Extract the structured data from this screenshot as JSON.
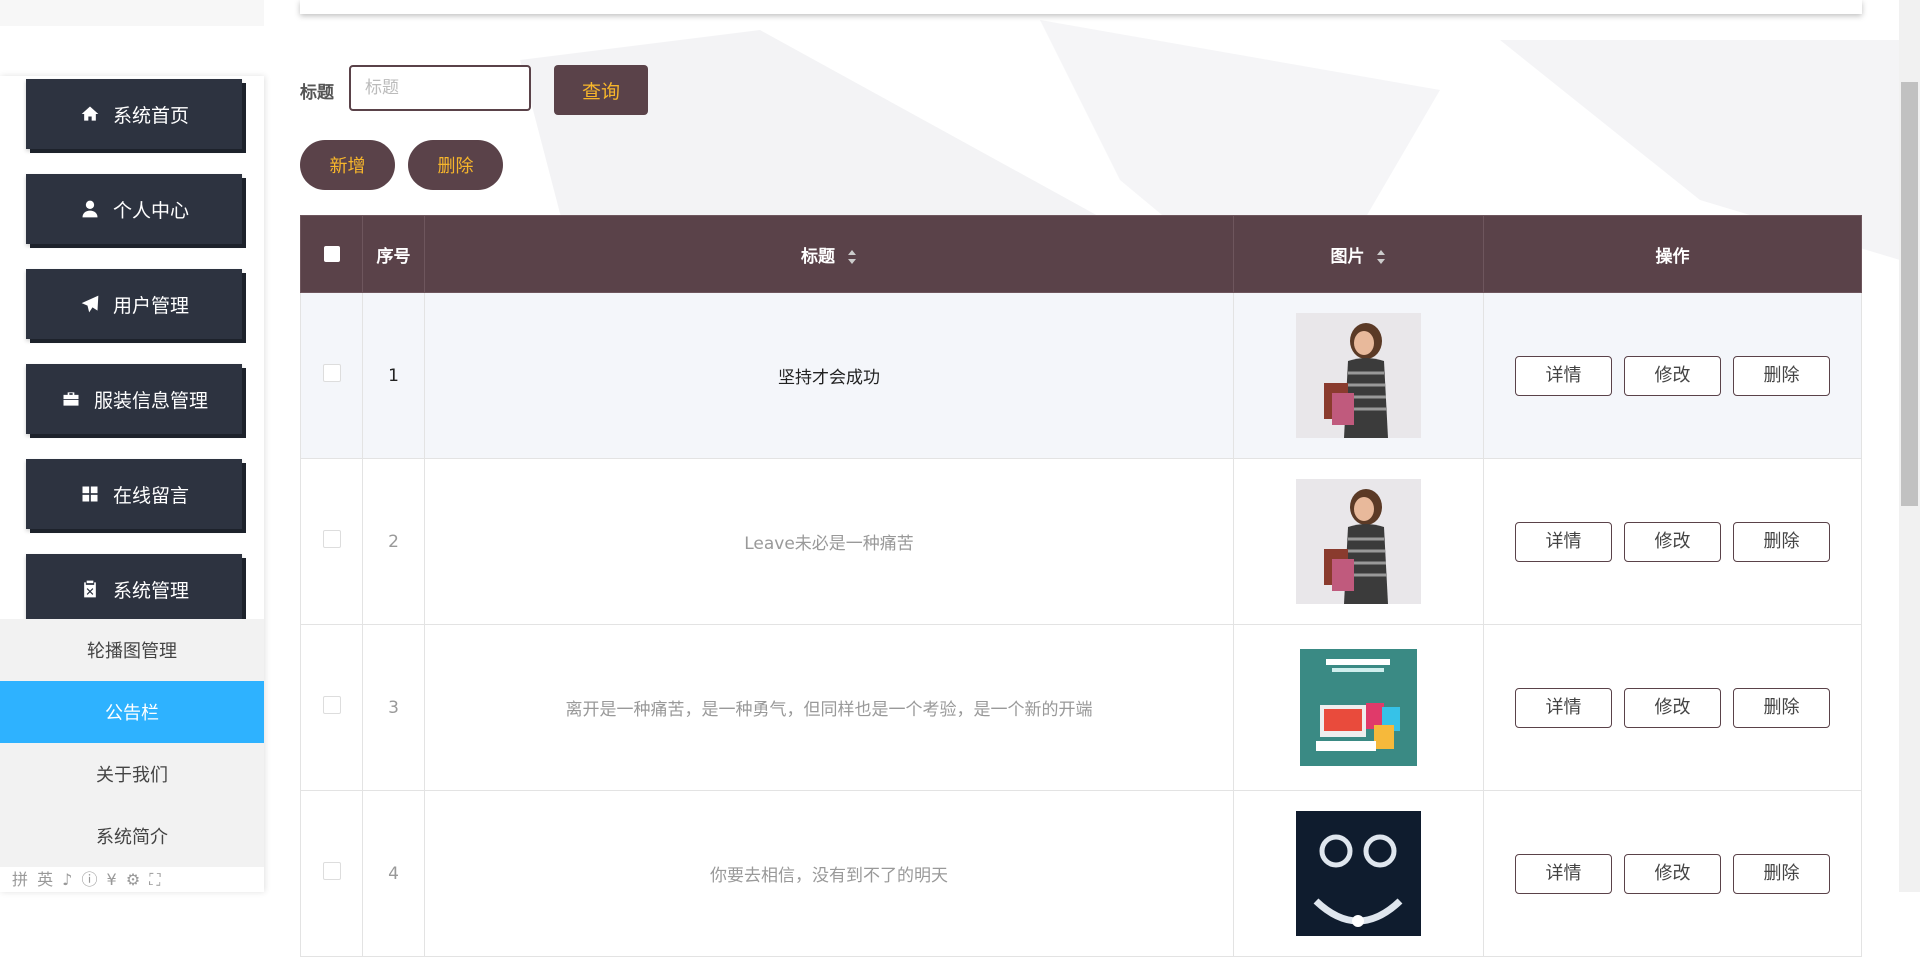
{
  "sidebar": {
    "items": [
      {
        "label": "系统首页",
        "icon": "home-icon"
      },
      {
        "label": "个人中心",
        "icon": "user-icon"
      },
      {
        "label": "用户管理",
        "icon": "paper-plane-icon"
      },
      {
        "label": "服装信息管理",
        "icon": "briefcase-icon"
      },
      {
        "label": "在线留言",
        "icon": "grid-icon"
      },
      {
        "label": "系统管理",
        "icon": "clipboard-icon"
      }
    ],
    "submenu": [
      {
        "label": "轮播图管理"
      },
      {
        "label": "公告栏",
        "active": true
      },
      {
        "label": "关于我们"
      },
      {
        "label": "系统简介"
      }
    ],
    "ime_text": "拼 英 ♪ ⓘ ¥ ⚙ ⛶"
  },
  "search": {
    "label": "标题",
    "placeholder": "标题",
    "query_label": "查询"
  },
  "actions": {
    "add_label": "新增",
    "delete_label": "删除"
  },
  "table": {
    "headers": {
      "index": "序号",
      "title": "标题",
      "image": "图片",
      "ops": "操作"
    },
    "rows": [
      {
        "index": "1",
        "title": "坚持才会成功",
        "image": "woman-shopping"
      },
      {
        "index": "2",
        "title": "Leave未必是一种痛苦",
        "image": "woman-shopping"
      },
      {
        "index": "3",
        "title": "离开是一种痛苦，是一种勇气，但同样也是一个考验，是一个新的开端",
        "image": "online-shopping"
      },
      {
        "index": "4",
        "title": "你要去相信，没有到不了的明天",
        "image": "jewelry"
      }
    ],
    "ops": {
      "detail": "详情",
      "edit": "修改",
      "delete": "删除"
    }
  },
  "colors": {
    "primary": "#5a4249",
    "accent": "#f7b62b",
    "sidebar": "#2d3340",
    "active": "#2eb2ff"
  }
}
